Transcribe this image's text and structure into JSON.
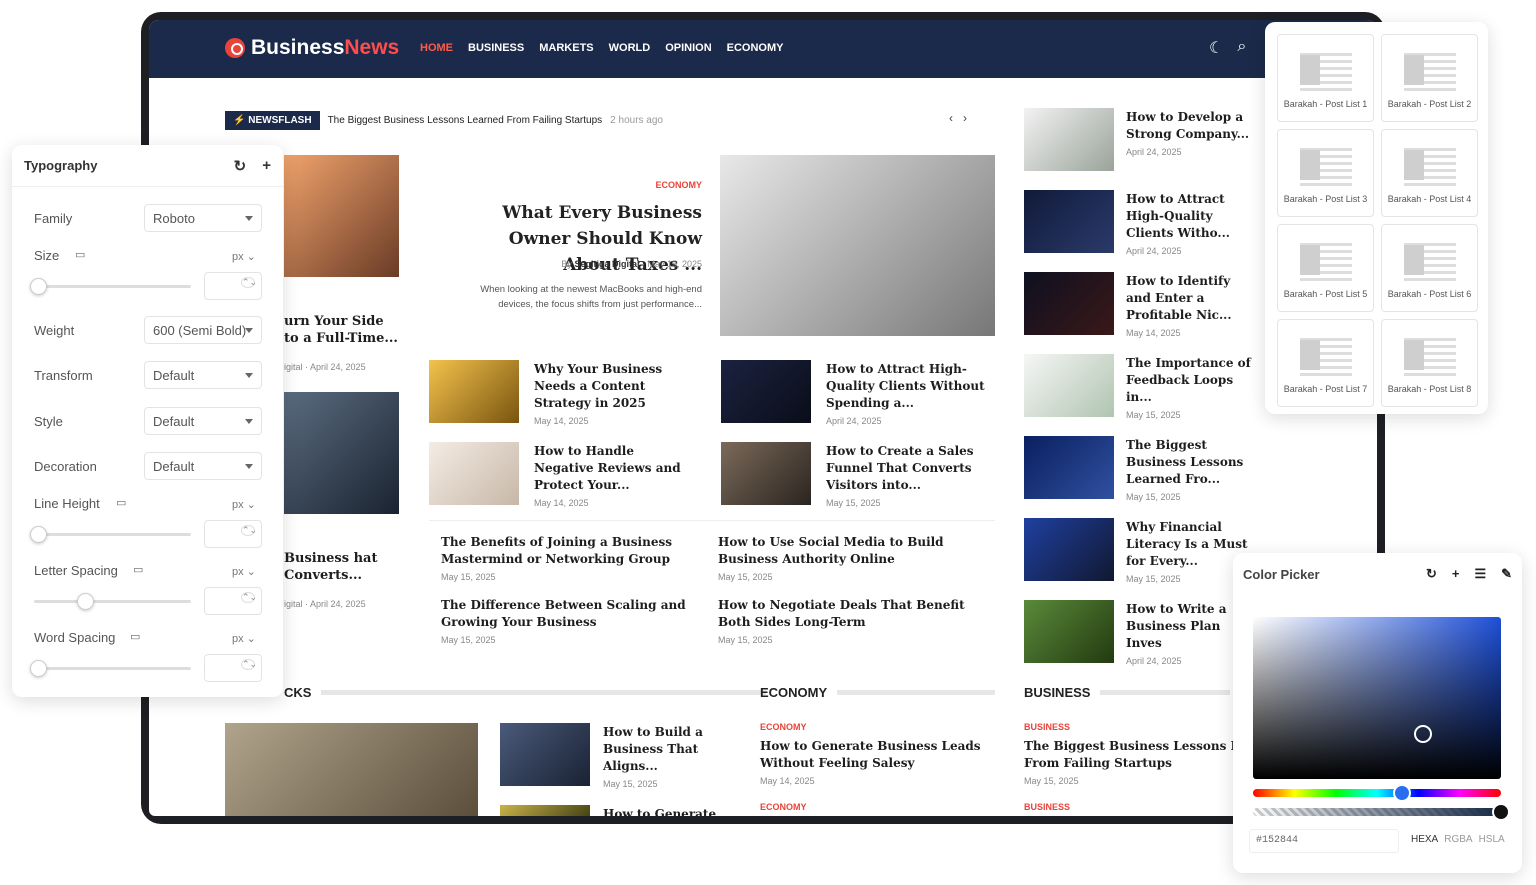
{
  "brand": {
    "part1": "Business",
    "part2": "News"
  },
  "menu": [
    "HOME",
    "BUSINESS",
    "MARKETS",
    "WORLD",
    "OPINION",
    "ECONOMY"
  ],
  "newsflash": {
    "badge": "NEWSFLASH",
    "text": "The Biggest Business Lessons Learned From Failing Startups",
    "time": "2 hours ago"
  },
  "hero": {
    "category": "ECONOMY",
    "title": "What Every Business Owner Should Know About Taxes ...",
    "author": "Segitiga Digital",
    "date": "May 15, 2025",
    "excerpt": "When looking at the newest MacBooks and high-end devices, the focus shifts from just performance..."
  },
  "left_cards": [
    {
      "title": "urn Your Side to a Full-Time...",
      "author": "igital",
      "date": "April 24, 2025"
    },
    {
      "title": "Business hat Converts...",
      "author": "igital",
      "date": "April 24, 2025"
    }
  ],
  "grid": [
    {
      "title": "Why Your Business Needs a Content Strategy in 2025",
      "date": "May 14, 2025"
    },
    {
      "title": "How to Attract High-Quality Clients Without Spending a...",
      "date": "April 24, 2025"
    },
    {
      "title": "How to Handle Negative Reviews and Protect Your...",
      "date": "May 14, 2025"
    },
    {
      "title": "How to Create a Sales Funnel That Converts Visitors into...",
      "date": "May 15, 2025"
    }
  ],
  "text_list": [
    {
      "title": "The Benefits of Joining a Business Mastermind or Networking Group",
      "date": "May 15, 2025"
    },
    {
      "title": "How to Use Social Media to Build Business Authority Online",
      "date": "May 15, 2025"
    },
    {
      "title": "The Difference Between Scaling and Growing Your Business",
      "date": "May 15, 2025"
    },
    {
      "title": "How to Negotiate Deals That Benefit Both Sides Long-Term",
      "date": "May 15, 2025"
    }
  ],
  "sidebar_posts": [
    {
      "title": "How to Develop a Strong Company...",
      "date": "April 24, 2025"
    },
    {
      "title": "How to Attract High-Quality Clients Witho...",
      "date": "April 24, 2025"
    },
    {
      "title": "How to Identify and Enter a Profitable Nic...",
      "date": "May 14, 2025"
    },
    {
      "title": "The Importance of Feedback Loops in...",
      "date": "May 15, 2025"
    },
    {
      "title": "The Biggest Business Lessons Learned Fro...",
      "date": "May 15, 2025"
    },
    {
      "title": "Why Financial Literacy Is a Must for Every...",
      "date": "May 15, 2025"
    },
    {
      "title": "How to Write a Business Plan Inves",
      "date": "April 24, 2025"
    }
  ],
  "sections": {
    "s1": "CKS",
    "s2": "ECONOMY",
    "s3": "BUSINESS"
  },
  "bottom": {
    "c1": {
      "title": "How to Build a Business That Aligns...",
      "date": "May 15, 2025"
    },
    "c1b": {
      "title": "How to Generate"
    },
    "c2": {
      "category": "ECONOMY",
      "title": "How to Generate Business Leads Without Feeling Salesy",
      "date": "May 14, 2025",
      "category2": "ECONOMY"
    },
    "c3": {
      "category": "BUSINESS",
      "title": "The Biggest Business Lessons Learned From Failing Startups",
      "date": "May 15, 2025",
      "category2": "BUSINESS"
    }
  },
  "typography": {
    "title": "Typography",
    "family_label": "Family",
    "family_value": "Roboto",
    "size_label": "Size",
    "unit": "px",
    "weight_label": "Weight",
    "weight_value": "600 (Semi Bold)",
    "transform_label": "Transform",
    "transform_value": "Default",
    "style_label": "Style",
    "style_value": "Default",
    "decoration_label": "Decoration",
    "decoration_value": "Default",
    "lineheight_label": "Line Height",
    "letterspacing_label": "Letter Spacing",
    "wordspacing_label": "Word Spacing"
  },
  "layouts": [
    "Barakah - Post List 1",
    "Barakah - Post List 2",
    "Barakah - Post List 3",
    "Barakah - Post List 4",
    "Barakah - Post List 5",
    "Barakah - Post List 6",
    "Barakah - Post List 7",
    "Barakah - Post List 8"
  ],
  "color_picker": {
    "title": "Color Picker",
    "hex": "#152844",
    "modes": [
      "HEXA",
      "RGBA",
      "HSLA"
    ],
    "hue": 0.6,
    "alpha": 1.0
  }
}
